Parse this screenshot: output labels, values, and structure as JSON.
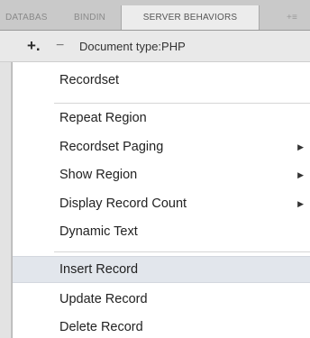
{
  "tabs": {
    "databases": "DATABAS",
    "bindings": "BINDIN",
    "server_behaviors": "SERVER BEHAVIORS",
    "overflow": "+≡"
  },
  "toolbar": {
    "add_label": "+.",
    "remove_label": "−",
    "document_type": "Document type:PHP"
  },
  "menu": {
    "recordset": "Recordset",
    "repeat_region": "Repeat Region",
    "recordset_paging": "Recordset Paging",
    "show_region": "Show Region",
    "display_record_count": "Display Record Count",
    "dynamic_text": "Dynamic Text",
    "insert_record": "Insert Record",
    "update_record": "Update Record",
    "delete_record": "Delete Record",
    "submenu_arrow": "▶"
  },
  "colors": {
    "highlight": "#e2e6ec",
    "tab_strip": "#c9c9c9",
    "toolbar": "#e9e9e9"
  }
}
